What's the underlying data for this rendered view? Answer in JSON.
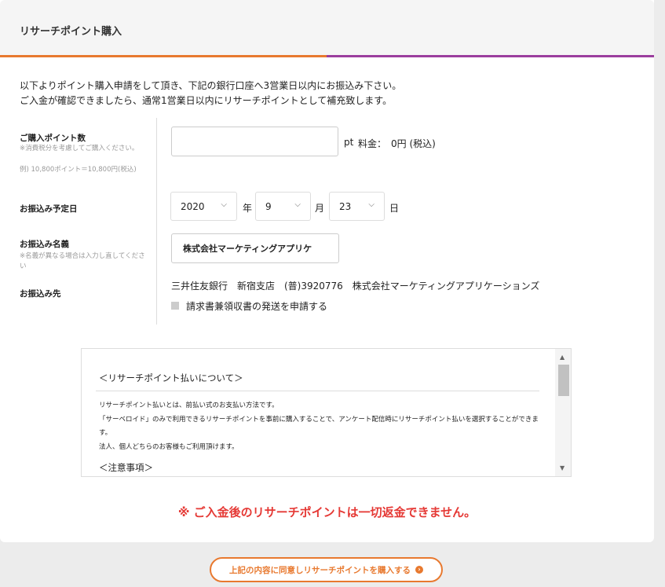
{
  "header": {
    "title": "リサーチポイント購入"
  },
  "intro": {
    "line1": "以下よりポイント購入申請をして頂き、下記の銀行口座へ3営業日以内にお振込み下さい。",
    "line2": "ご入金が確認できましたら、通常1営業日以内にリサーチポイントとして補充致します。"
  },
  "form": {
    "points": {
      "label": "ご購入ポイント数",
      "note1": "※消費税分を考慮してご購入ください。",
      "note2": "例) 10,800ポイント＝10,800円(税込)",
      "value": "",
      "unit": "pt",
      "fee": "料金：",
      "fee_value": "0円 (税込)"
    },
    "date": {
      "label": "お振込み予定日",
      "year": "2020",
      "year_unit": "年",
      "month": "9",
      "month_unit": "月",
      "day": "23",
      "day_unit": "日"
    },
    "name": {
      "label": "お振込み名義",
      "note": "※名義が異なる場合は入力し直してください",
      "value": "株式会社マーケティングアプリケ"
    },
    "dest": {
      "label": "お振込み先",
      "bank": "三井住友銀行　新宿支店　(普)3920776　株式会社マーケティングアプリケーションズ"
    },
    "invoice": {
      "label": "請求書兼領収書の発送を申請する"
    }
  },
  "terms": {
    "heading1": "＜リサーチポイント払いについて＞",
    "p1": "リサーチポイント払いとは、前払い式のお支払い方法です。",
    "p2": "「サーベロイド」のみで利用できるリサーチポイントを事前に購入することで、アンケート配信時にリサーチポイント払いを選択することができます。",
    "p3": "法人、個人どちらのお客様もご利用頂けます。",
    "heading2": "＜注意事項＞"
  },
  "warning": "※ ご入金後のリサーチポイントは一切返金できません。",
  "submit": {
    "label": "上記の内容に同意しリサーチポイントを購入する"
  },
  "colors": {
    "accent_orange": "#e8792f",
    "accent_purple": "#9b3e9e",
    "warning_red": "#e53935"
  }
}
